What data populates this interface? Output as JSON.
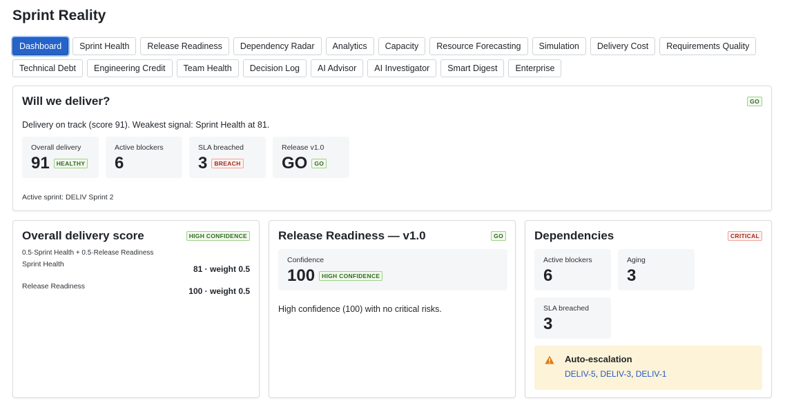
{
  "app": {
    "title": "Sprint Reality"
  },
  "tabs": [
    {
      "label": "Dashboard",
      "active": true
    },
    {
      "label": "Sprint Health"
    },
    {
      "label": "Release Readiness"
    },
    {
      "label": "Dependency Radar"
    },
    {
      "label": "Analytics"
    },
    {
      "label": "Capacity"
    },
    {
      "label": "Resource Forecasting"
    },
    {
      "label": "Simulation"
    },
    {
      "label": "Delivery Cost"
    },
    {
      "label": "Requirements Quality"
    },
    {
      "label": "Technical Debt"
    },
    {
      "label": "Engineering Credit"
    },
    {
      "label": "Team Health"
    },
    {
      "label": "Decision Log"
    },
    {
      "label": "AI Advisor"
    },
    {
      "label": "AI Investigator"
    },
    {
      "label": "Smart Digest"
    },
    {
      "label": "Enterprise"
    }
  ],
  "deliver": {
    "title": "Will we deliver?",
    "badge": "GO",
    "summary": "Delivery on track (score 91). Weakest signal: Sprint Health at 81.",
    "stats": [
      {
        "label": "Overall delivery",
        "value": "91",
        "badge": "HEALTHY",
        "tone": "green"
      },
      {
        "label": "Active blockers",
        "value": "6"
      },
      {
        "label": "SLA breached",
        "value": "3",
        "badge": "BREACH",
        "tone": "red"
      },
      {
        "label": "Release v1.0",
        "value": "GO",
        "badge": "GO",
        "tone": "green"
      }
    ],
    "footnote": "Active sprint: DELIV Sprint 2"
  },
  "score": {
    "title": "Overall delivery score",
    "badge": "HIGH CONFIDENCE",
    "formula": "0.5·Sprint Health + 0.5·Release Readiness",
    "rows": [
      {
        "label": "Sprint Health",
        "value": "81 · weight 0.5"
      },
      {
        "label": "Release Readiness",
        "value": "100 · weight 0.5"
      }
    ]
  },
  "release": {
    "title": "Release Readiness — v1.0",
    "badge": "GO",
    "confidence_label": "Confidence",
    "confidence_value": "100",
    "confidence_badge": "HIGH CONFIDENCE",
    "description": "High confidence (100) with no critical risks."
  },
  "deps": {
    "title": "Dependencies",
    "badge": "CRITICAL",
    "stats": [
      {
        "label": "Active blockers",
        "value": "6"
      },
      {
        "label": "Aging",
        "value": "3"
      },
      {
        "label": "SLA breached",
        "value": "3"
      }
    ],
    "escalation": {
      "title": "Auto-escalation",
      "icon": "warning-icon",
      "links": [
        "DELIV-5",
        "DELIV-3",
        "DELIV-1"
      ],
      "separator": ", "
    }
  },
  "colors": {
    "accent": "#2563c9",
    "ok": "#2d6a1f",
    "danger": "#a12a1c",
    "warning": "#e07b12",
    "link": "#2158c4"
  }
}
